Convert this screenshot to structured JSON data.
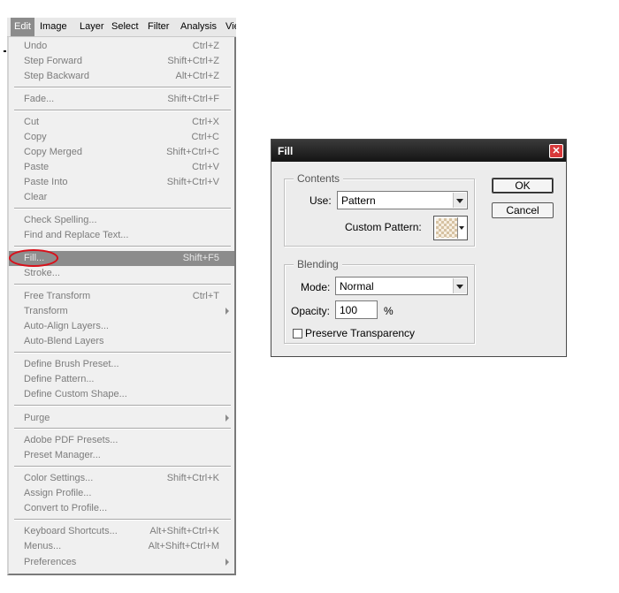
{
  "menubar": {
    "items": [
      {
        "label": "Edit",
        "active": true
      },
      {
        "label": "Image"
      },
      {
        "label": "Layer"
      },
      {
        "label": "Select"
      },
      {
        "label": "Filter"
      },
      {
        "label": "Analysis"
      },
      {
        "label": "Vie"
      }
    ]
  },
  "edit_menu": {
    "undo": {
      "label": "Undo",
      "shortcut": "Ctrl+Z"
    },
    "step_forward": {
      "label": "Step Forward",
      "shortcut": "Shift+Ctrl+Z"
    },
    "step_backward": {
      "label": "Step Backward",
      "shortcut": "Alt+Ctrl+Z"
    },
    "fade": {
      "label": "Fade...",
      "shortcut": "Shift+Ctrl+F"
    },
    "cut": {
      "label": "Cut",
      "shortcut": "Ctrl+X"
    },
    "copy": {
      "label": "Copy",
      "shortcut": "Ctrl+C"
    },
    "copy_merged": {
      "label": "Copy Merged",
      "shortcut": "Shift+Ctrl+C"
    },
    "paste": {
      "label": "Paste",
      "shortcut": "Ctrl+V"
    },
    "paste_into": {
      "label": "Paste Into",
      "shortcut": "Shift+Ctrl+V"
    },
    "clear": {
      "label": "Clear"
    },
    "check_spelling": {
      "label": "Check Spelling..."
    },
    "find_replace": {
      "label": "Find and Replace Text..."
    },
    "fill": {
      "label": "Fill...",
      "shortcut": "Shift+F5"
    },
    "stroke": {
      "label": "Stroke..."
    },
    "free_transform": {
      "label": "Free Transform",
      "shortcut": "Ctrl+T"
    },
    "transform": {
      "label": "Transform"
    },
    "auto_align": {
      "label": "Auto-Align Layers..."
    },
    "auto_blend": {
      "label": "Auto-Blend Layers"
    },
    "define_brush": {
      "label": "Define Brush Preset..."
    },
    "define_pattern": {
      "label": "Define Pattern..."
    },
    "define_shape": {
      "label": "Define Custom Shape..."
    },
    "purge": {
      "label": "Purge"
    },
    "pdf_presets": {
      "label": "Adobe PDF Presets..."
    },
    "preset_manager": {
      "label": "Preset Manager..."
    },
    "color_settings": {
      "label": "Color Settings...",
      "shortcut": "Shift+Ctrl+K"
    },
    "assign_profile": {
      "label": "Assign Profile..."
    },
    "convert_profile": {
      "label": "Convert to Profile..."
    },
    "keyboard_shortcuts": {
      "label": "Keyboard Shortcuts...",
      "shortcut": "Alt+Shift+Ctrl+K"
    },
    "menus": {
      "label": "Menus...",
      "shortcut": "Alt+Shift+Ctrl+M"
    },
    "preferences": {
      "label": "Preferences"
    }
  },
  "dialog": {
    "title": "Fill",
    "close_glyph": "✕",
    "contents": {
      "legend": "Contents",
      "use_label": "Use:",
      "use_value": "Pattern",
      "custom_pattern_label": "Custom Pattern:"
    },
    "blending": {
      "legend": "Blending",
      "mode_label": "Mode:",
      "mode_value": "Normal",
      "opacity_label": "Opacity:",
      "opacity_value": "100",
      "opacity_unit": "%",
      "preserve_label": "Preserve Transparency",
      "preserve_checked": false
    },
    "ok_label": "OK",
    "cancel_label": "Cancel"
  },
  "colors": {
    "highlight": "#8c8c8c",
    "annotation_circle": "#d8101a",
    "titlebar": "#1a1a1a"
  }
}
